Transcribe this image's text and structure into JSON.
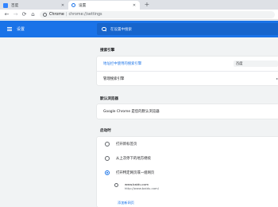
{
  "tabs": [
    {
      "title": "百度",
      "active": false,
      "icon": "baidu-favicon"
    },
    {
      "title": "设置",
      "active": true,
      "icon": "settings-gear-icon"
    }
  ],
  "toolbar": {
    "back": "←",
    "forward": "→",
    "reload": "⟳",
    "home": "⌂",
    "url_host": "Chrome",
    "url_sep": "|",
    "url_path": "chrome://settings"
  },
  "header": {
    "title": "设置",
    "search_placeholder": "在设置中搜索"
  },
  "search_engine": {
    "section_title": "搜索引擎",
    "default_label": "地址栏中使用的搜索引擎",
    "default_value": "百度",
    "manage_label": "管理搜索引擎"
  },
  "default_browser": {
    "section_title": "默认浏览器",
    "text": "Google Chrome 是您的默认浏览器"
  },
  "on_startup": {
    "section_title": "启动时",
    "options": [
      {
        "label": "打开新标签页",
        "checked": false
      },
      {
        "label": "从上次停下的地方继续",
        "checked": false
      },
      {
        "label": "打开特定网页或一组网页",
        "checked": true
      }
    ],
    "page_title": "www.baidu.com",
    "page_url": "http://www.baidu.com/",
    "add_link": "添加新网页"
  },
  "colors": {
    "accent": "#1a73e8",
    "background": "#f1f3f4"
  }
}
